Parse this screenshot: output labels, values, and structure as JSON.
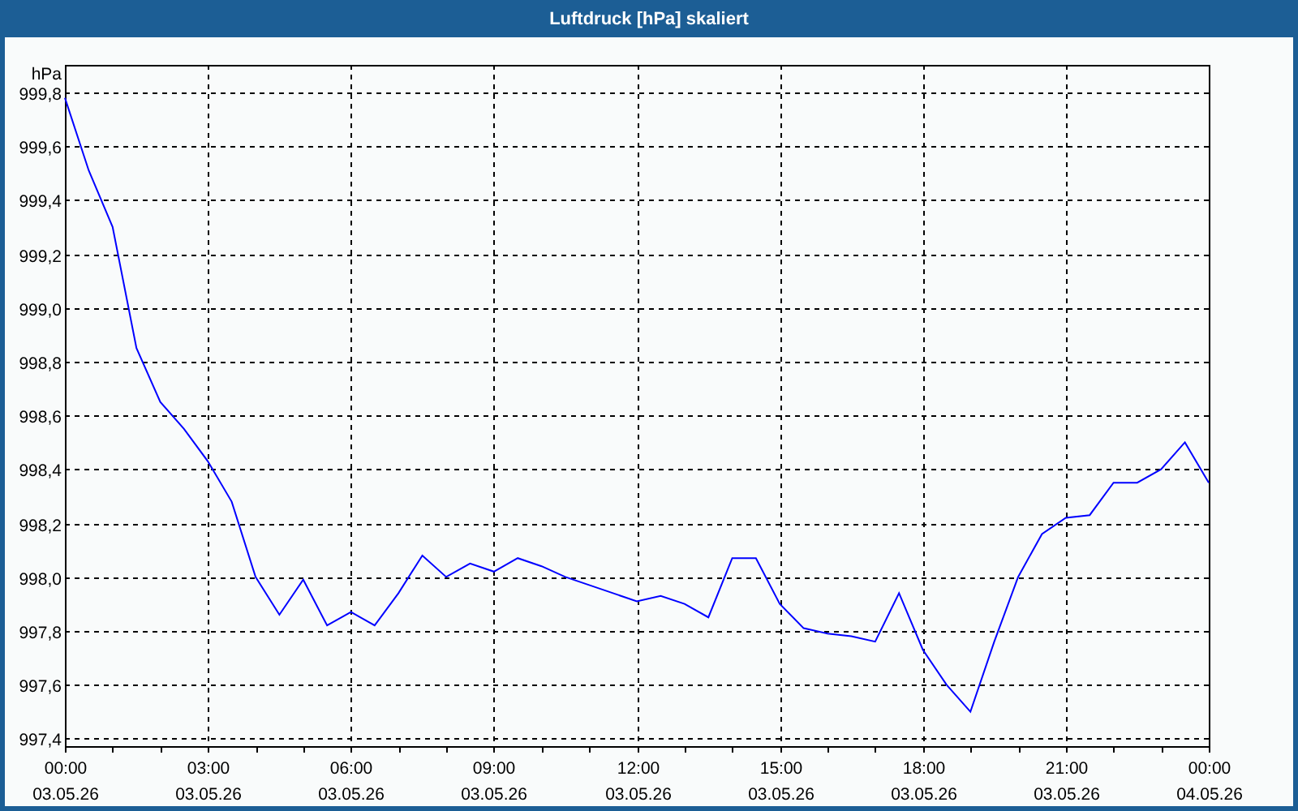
{
  "window": {
    "title": "Luftdruck [hPa] skaliert"
  },
  "chart": {
    "chart_data": {
      "type": "line",
      "ylabel": "hPa",
      "grid": true,
      "categories": [
        "00:00 03.05.26",
        null,
        null,
        null,
        null,
        null,
        "03:00 03.05.26",
        null,
        null,
        null,
        null,
        null,
        "06:00 03.05.26",
        null,
        null,
        null,
        null,
        null,
        "09:00 03.05.26",
        null,
        null,
        null,
        null,
        null,
        "12:00 03.05.26",
        null,
        null,
        null,
        null,
        null,
        "15:00 03.05.26",
        null,
        null,
        null,
        null,
        null,
        "18:00 03.05.26",
        null,
        null,
        null,
        null,
        null,
        "21:00 03.05.26",
        null,
        null,
        null,
        null,
        null,
        "00:00 04.05.26"
      ],
      "series": [
        {
          "color": "#0000ff",
          "values": [
            999.78,
            999.51,
            999.3,
            998.85,
            998.65,
            998.55,
            998.43,
            998.28,
            998.0,
            997.86,
            997.99,
            997.82,
            997.87,
            997.82,
            997.94,
            998.08,
            998.0,
            998.05,
            998.02,
            998.07,
            998.04,
            998.0,
            997.97,
            997.94,
            997.91,
            997.93,
            997.9,
            997.85,
            998.07,
            998.07,
            997.9,
            997.81,
            997.79,
            997.78,
            997.76,
            997.94,
            997.73,
            997.6,
            997.5,
            997.76,
            998.0,
            998.16,
            998.22,
            998.23,
            998.35,
            998.35,
            998.4,
            998.5,
            998.35
          ]
        }
      ],
      "ylim": [
        997.372,
        999.902
      ],
      "yticks": [
        {
          "value": 997.4,
          "label": "997,4"
        },
        {
          "value": 997.6,
          "label": "997,6"
        },
        {
          "value": 997.8,
          "label": "997,8"
        },
        {
          "value": 998.0,
          "label": "998,0"
        },
        {
          "value": 998.2,
          "label": "998,2"
        },
        {
          "value": 998.4,
          "label": "998,4"
        },
        {
          "value": 998.6,
          "label": "998,6"
        },
        {
          "value": 998.8,
          "label": "998,8"
        },
        {
          "value": 999.0,
          "label": "999,0"
        },
        {
          "value": 999.2,
          "label": "999,2"
        },
        {
          "value": 999.4,
          "label": "999,4"
        },
        {
          "value": 999.6,
          "label": "999,6"
        },
        {
          "value": 999.8,
          "label": "999,8"
        }
      ]
    }
  }
}
